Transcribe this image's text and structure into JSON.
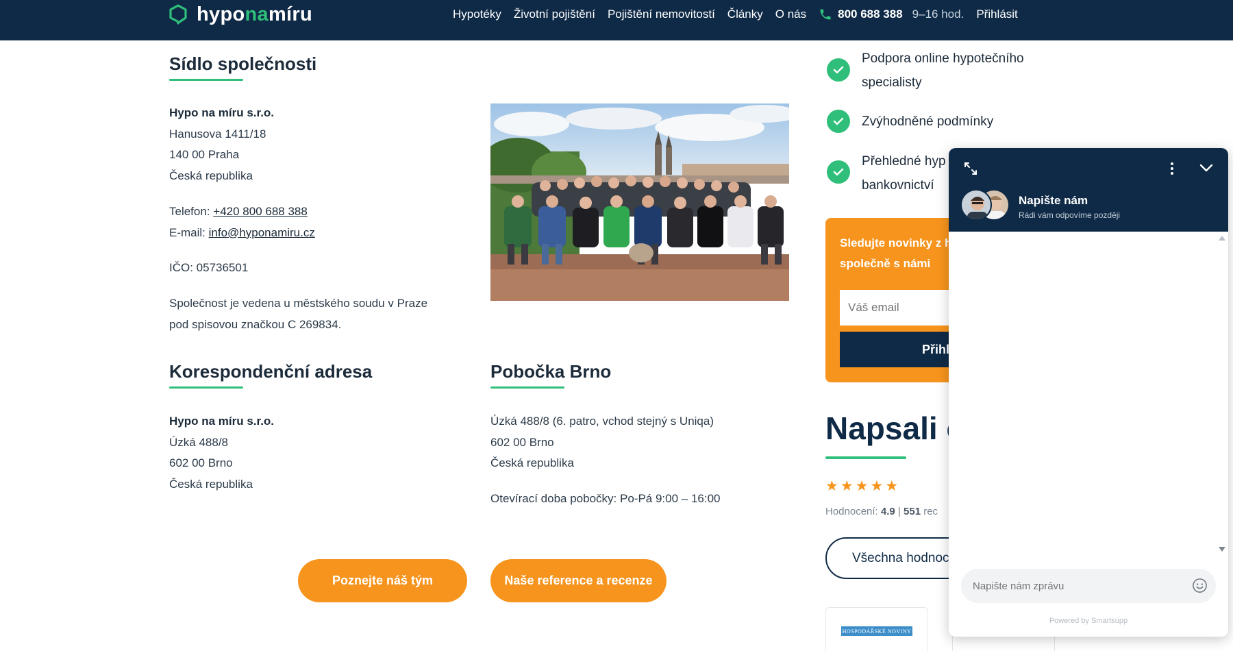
{
  "brand": {
    "logo_part1": "hypo",
    "logo_part2": "na",
    "logo_part3": "míru"
  },
  "nav": {
    "items": [
      "Hypotéky",
      "Životní pojištění",
      "Pojištění nemovitostí",
      "Články",
      "O nás"
    ],
    "phone": "800 688 388",
    "hours": "9–16 hod.",
    "login": "Přihlásit"
  },
  "seat": {
    "title": "Sídlo společnosti",
    "company": "Hypo na míru s.r.o.",
    "street": "Hanusova 1411/18",
    "city": "140 00 Praha",
    "country": "Česká republika",
    "phone_label": "Telefon:",
    "phone_value": "+420 800 688 388",
    "email_label": "E-mail:",
    "email_value": "info@hyponamiru.cz",
    "ico": "IČO: 05736501",
    "register_line1": "Společnost je vedena u městského soudu v Praze",
    "register_line2": "pod spisovou značkou C 269834."
  },
  "correspondence": {
    "title": "Korespondenční adresa",
    "company": "Hypo na míru s.r.o.",
    "street": "Úzká 488/8",
    "city": "602 00 Brno",
    "country": "Česká republika"
  },
  "branch": {
    "title": "Pobočka Brno",
    "street": "Úzká 488/8 (6. patro, vchod stejný s Uniqa)",
    "city": "602 00 Brno",
    "country": "Česká republika",
    "hours": "Otevírací doba pobočky: Po-Pá 9:00 – 16:00"
  },
  "buttons": {
    "team": "Poznejte náš tým",
    "references": "Naše reference a recenze"
  },
  "benefits": [
    {
      "line1": "Podpora online hypotečního",
      "line2": "specialisty"
    },
    {
      "line1": "Zvýhodněné podmínky",
      "line2": ""
    },
    {
      "line1": "Přehledné hyp",
      "line2": "bankovnictví"
    }
  ],
  "newsletter": {
    "text_line1": "Sledujte novinky z h",
    "text_line2": "společně s námi",
    "email_placeholder": "Váš email",
    "submit": "Přihl"
  },
  "reviews": {
    "heading": "Napsali o",
    "stars": 5,
    "rating_label": "Hodnocení:",
    "rating_value": "4.9",
    "rating_sep": "|",
    "count": "551",
    "count_suffix": "rec",
    "all_button": "Všechna hodnoc"
  },
  "press": {
    "logo1": "HOSPODÁŘSKÉ NOVINY"
  },
  "chat": {
    "title": "Napište nám",
    "subtitle": "Rádi vám odpovíme později",
    "input_placeholder": "Napište nám zprávu",
    "powered": "Powered by Smartsupp"
  },
  "colors": {
    "navy": "#0f2a47",
    "green": "#2fbf7a",
    "orange": "#f7941d"
  }
}
